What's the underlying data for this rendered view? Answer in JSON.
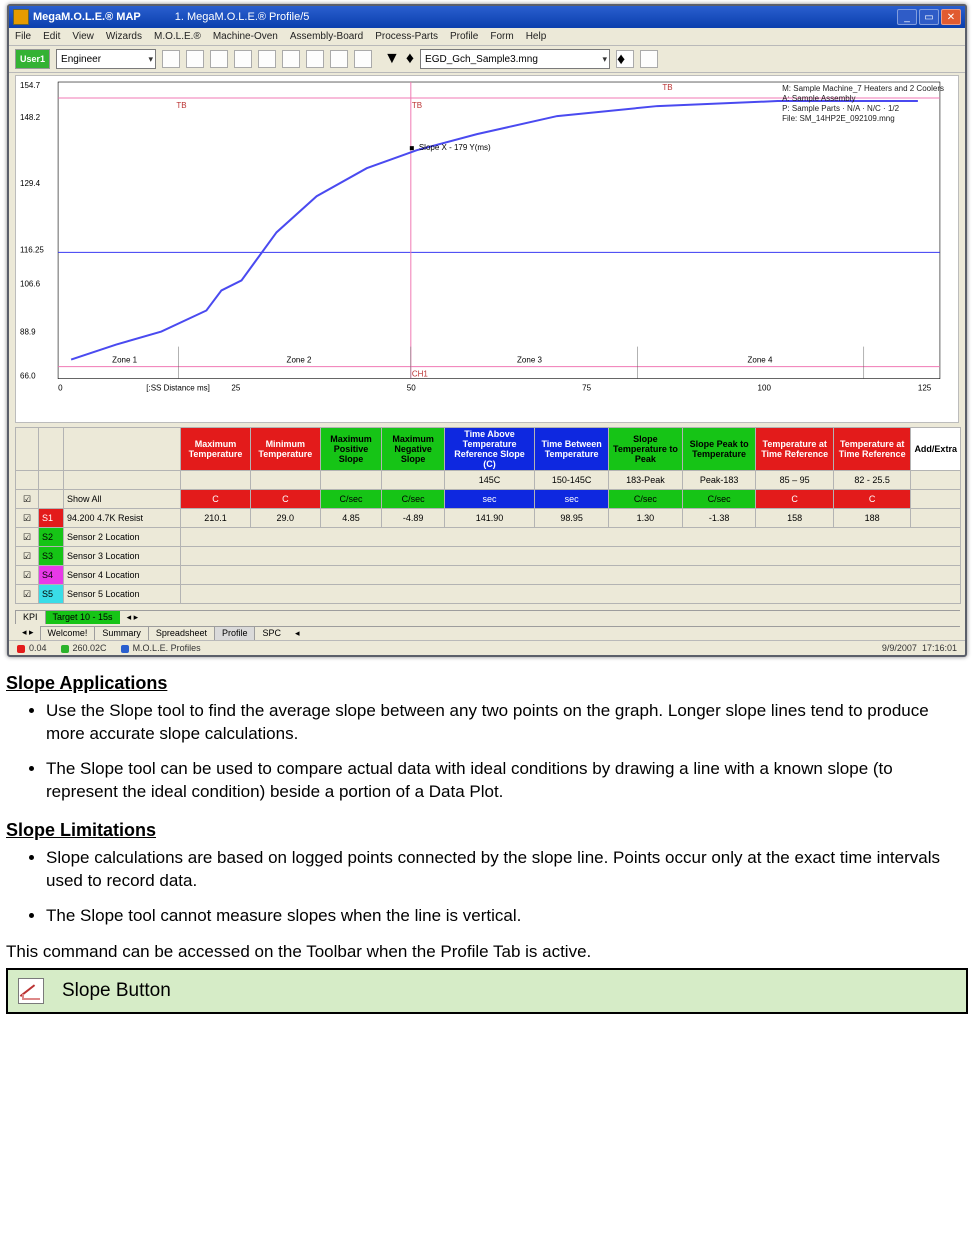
{
  "window": {
    "title1": "MegaM.O.L.E.® MAP",
    "title2": "1. MegaM.O.L.E.® Profile/5",
    "menu": [
      "File",
      "Edit",
      "View",
      "Wizards",
      "M.O.L.E.®",
      "Machine-Oven",
      "Assembly-Board",
      "Process-Parts",
      "Profile",
      "Form",
      "Help"
    ],
    "userBtn": "User1",
    "roleCombo": "Engineer",
    "fileCombo": "EGD_Gch_Sample3.mng"
  },
  "chart_data": {
    "type": "line",
    "x": [
      0,
      12,
      25,
      50,
      75,
      100,
      125
    ],
    "series": [
      {
        "name": "Profile",
        "values": [
          60,
          72,
          100,
          142,
          148,
          150,
          151
        ]
      }
    ],
    "xlim": [
      0,
      125
    ],
    "ylim": [
      60,
      156
    ],
    "yticks": [
      66.0,
      88.9,
      106.6,
      129.4,
      148.2,
      154.7
    ],
    "xticks": [
      0,
      25,
      50,
      75,
      100,
      125
    ],
    "refHorz": [
      116.25,
      150.0
    ],
    "refVert": [
      50
    ],
    "zones": [
      "Zone 1",
      "Zone 2",
      "Zone 3",
      "Zone 4"
    ],
    "cursorLabel": "Slope X - 179 Y(ms)",
    "xlabel": "[:SS Distance ms]",
    "legend": [
      "M: Sample Machine_7 Heaters and 2 Coolers",
      "A: Sample Assembly",
      "P: Sample Parts · N/A · N/C · 1/2",
      "File: SM_14HP2E_092109.mng"
    ]
  },
  "grid": {
    "headers": [
      {
        "cls": "hdr-red",
        "t": "Maximum Temperature"
      },
      {
        "cls": "hdr-red",
        "t": "Minimum Temperature"
      },
      {
        "cls": "hdr-grn",
        "t": "Maximum Positive Slope"
      },
      {
        "cls": "hdr-grn",
        "t": "Maximum Negative Slope"
      },
      {
        "cls": "hdr-blu",
        "t": "Time Above Temperature Reference Slope (C)"
      },
      {
        "cls": "hdr-blu",
        "t": "Time Between Temperature"
      },
      {
        "cls": "hdr-grn",
        "t": "Slope Temperature to Peak"
      },
      {
        "cls": "hdr-grn",
        "t": "Slope Peak to Temperature"
      },
      {
        "cls": "hdr-red",
        "t": "Temperature at Time Reference"
      },
      {
        "cls": "hdr-red",
        "t": "Temperature at Time Reference"
      },
      {
        "cls": "hdr-wht",
        "t": "Add/Extra"
      }
    ],
    "row2": [
      "",
      "",
      "",
      "",
      "145C",
      "150-145C",
      "183-Peak",
      "Peak-183",
      "85 – 95",
      "82 - 25.5",
      ""
    ],
    "row3": [
      "C",
      "C",
      "C/sec",
      "C/sec",
      "sec",
      "sec",
      "C/sec",
      "C/sec",
      "C",
      "C",
      ""
    ],
    "row3cls": [
      "row-red",
      "row-red",
      "row-grn",
      "row-grn",
      "row-blu",
      "row-blu",
      "row-grn",
      "row-grn",
      "row-red",
      "row-red",
      ""
    ],
    "showAll": "Show All",
    "sensors": [
      {
        "cls": "senred",
        "tag": "S1",
        "name": "94.200 4.7K Resist",
        "v": [
          "210.1",
          "29.0",
          "4.85",
          "-4.89",
          "141.90",
          "98.95",
          "1.30",
          "-1.38",
          "158",
          "188"
        ]
      },
      {
        "cls": "sengreen",
        "tag": "S2",
        "name": "Sensor 2 Location",
        "v": [
          "",
          "",
          "",
          "",
          "",
          "",
          "",
          "",
          "",
          ""
        ]
      },
      {
        "cls": "sengreen",
        "tag": "S3",
        "name": "Sensor 3 Location",
        "v": [
          "",
          "",
          "",
          "",
          "",
          "",
          "",
          "",
          "",
          ""
        ]
      },
      {
        "cls": "senmag",
        "tag": "S4",
        "name": "Sensor 4 Location",
        "v": [
          "",
          "",
          "",
          "",
          "",
          "",
          "",
          "",
          "",
          ""
        ]
      },
      {
        "cls": "sencyan",
        "tag": "S5",
        "name": "Sensor 5 Location",
        "v": [
          "",
          "",
          "",
          "",
          "",
          "",
          "",
          "",
          "",
          ""
        ]
      }
    ],
    "kpiTab": "KPI",
    "targetTab": "Target 10 - 15s"
  },
  "tabs": [
    "Welcome!",
    "Summary",
    "Spreadsheet",
    "Profile",
    "SPC"
  ],
  "tabActive": 3,
  "status": {
    "a": "0.04",
    "b": "260.02C",
    "c": "M.O.L.E. Profiles",
    "date": "9/9/2007",
    "time": "17:16:01"
  },
  "doc": {
    "h1": "Slope Applications",
    "b1": "Use the Slope tool to find the average slope between any two points on the graph. Longer slope lines tend to produce more accurate slope calculations.",
    "b2": "The Slope tool can be used to compare actual data with ideal conditions by drawing a line with a known slope (to represent the ideal condition) beside a portion of a Data Plot.",
    "h2": "Slope Limitations",
    "b3": "Slope calculations are based on logged points connected by the slope line. Points occur only at the exact time intervals used to record data.",
    "b4": "The Slope tool cannot measure slopes when the line is vertical.",
    "p": "This command can be accessed on the Toolbar when the Profile Tab is active.",
    "slopeBtn": "Slope Button"
  }
}
